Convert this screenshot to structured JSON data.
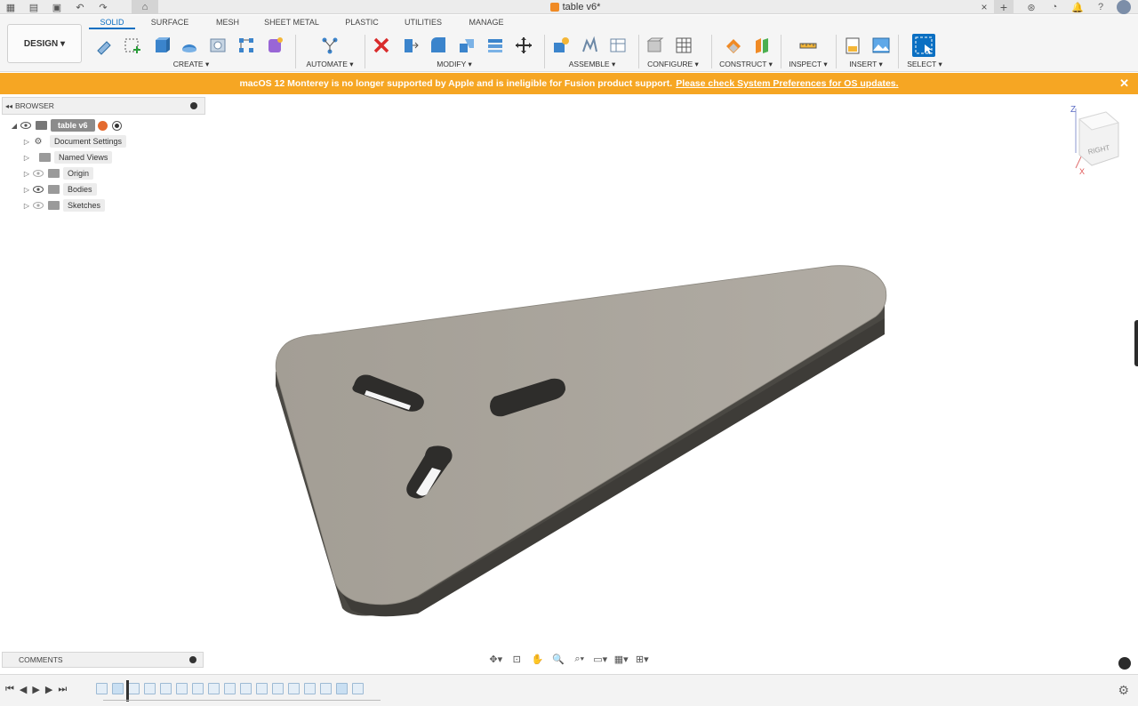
{
  "app": {
    "doc_title": "table v6*"
  },
  "design_button": {
    "label": "DESIGN ▾"
  },
  "tabs": [
    "SOLID",
    "SURFACE",
    "MESH",
    "SHEET METAL",
    "PLASTIC",
    "UTILITIES",
    "MANAGE"
  ],
  "groups": {
    "create": "CREATE ▾",
    "automate": "AUTOMATE ▾",
    "modify": "MODIFY ▾",
    "assemble": "ASSEMBLE ▾",
    "configure": "CONFIGURE ▾",
    "construct": "CONSTRUCT ▾",
    "inspect": "INSPECT ▾",
    "insert": "INSERT ▾",
    "select": "SELECT ▾"
  },
  "banner": {
    "message": "macOS 12 Monterey is no longer supported by Apple and is ineligible for Fusion product support.",
    "link": "Please check System Preferences for OS updates.",
    "close": "✕"
  },
  "browser": {
    "title": "BROWSER",
    "root": "table v6",
    "items": [
      {
        "label": "Document Settings",
        "icon": "gear-icon"
      },
      {
        "label": "Named Views",
        "icon": "folder-icon"
      },
      {
        "label": "Origin",
        "icon": "folder-icon"
      },
      {
        "label": "Bodies",
        "icon": "folder-icon"
      },
      {
        "label": "Sketches",
        "icon": "folder-icon"
      }
    ]
  },
  "comments": {
    "title": "COMMENTS"
  },
  "viewcube": {
    "face": "RIGHT",
    "axis_z": "Z",
    "axis_x": "X"
  },
  "colors": {
    "accent": "#0a6fc2",
    "banner": "#f6a623",
    "body_top": "#a9a49b",
    "body_side": "#4a4843"
  }
}
